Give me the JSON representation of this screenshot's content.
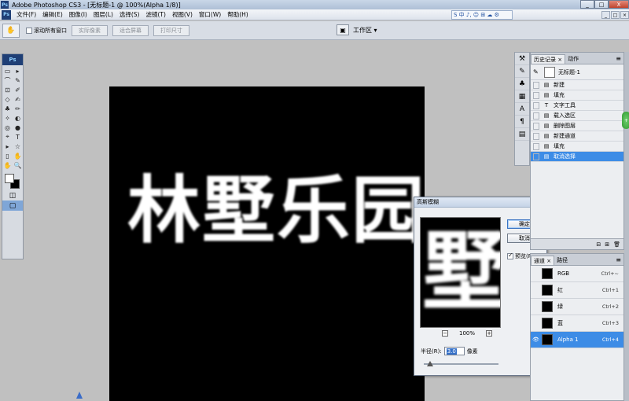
{
  "window": {
    "title": "Adobe Photoshop CS3 - [无标题-1 @ 100%(Alpha 1/8)]",
    "logo": "Ps",
    "controls": [
      "_",
      "□",
      "X"
    ]
  },
  "menu": {
    "logo": "Ps",
    "items": [
      "文件(F)",
      "编辑(E)",
      "图像(I)",
      "图层(L)",
      "选择(S)",
      "滤镜(T)",
      "视图(V)",
      "窗口(W)",
      "帮助(H)"
    ]
  },
  "ime": {
    "label": "S 中 ♪, ☺ ⊞ ☁ ⚙"
  },
  "options": {
    "scroll_all_label": "滚动所有窗口",
    "actual_pixels": "实际像素",
    "fit_screen": "适合屏幕",
    "print_size": "打印尺寸",
    "workspace": "工作区 ▾"
  },
  "toolbox": {
    "logo": "Ps",
    "tools": [
      "▭",
      "▸",
      "⌒",
      "✎",
      "⊡",
      "✐",
      "◇",
      "✍",
      "♣",
      "✏",
      "✧",
      "◐",
      "◎",
      "●",
      "⌖",
      "T",
      "▸",
      "☆",
      "▯",
      "✋",
      "✋",
      "🔍"
    ]
  },
  "canvas": {
    "text": "林墅乐园"
  },
  "dialog": {
    "title": "高斯模糊",
    "preview_text": "墅乐",
    "ok": "确定",
    "cancel": "取消",
    "preview_label": "预览(P)",
    "zoom": "100%",
    "radius_label": "半径(R):",
    "radius_value": "3.0",
    "radius_unit": "像素"
  },
  "history": {
    "tab_history": "历史记录 ×",
    "tab_actions": "动作",
    "snapshot": "无标题-1",
    "items": [
      {
        "icon": "▤",
        "label": "新建"
      },
      {
        "icon": "▤",
        "label": "填充"
      },
      {
        "icon": "T",
        "label": "文字工具"
      },
      {
        "icon": "▤",
        "label": "载入选区"
      },
      {
        "icon": "▤",
        "label": "删除图层"
      },
      {
        "icon": "▤",
        "label": "新建通道"
      },
      {
        "icon": "▤",
        "label": "填充"
      },
      {
        "icon": "▤",
        "label": "取消选择"
      }
    ],
    "footer": [
      "⊟",
      "⊞",
      "🗑"
    ]
  },
  "channels": {
    "tab_channels": "通道 ×",
    "tab_paths": "路径",
    "rows": [
      {
        "name": "RGB",
        "shortcut": "Ctrl+~"
      },
      {
        "name": "红",
        "shortcut": "Ctrl+1"
      },
      {
        "name": "绿",
        "shortcut": "Ctrl+2"
      },
      {
        "name": "蓝",
        "shortcut": "Ctrl+3"
      },
      {
        "name": "Alpha 1",
        "shortcut": "Ctrl+4"
      }
    ]
  },
  "colors": {
    "accent": "#3d8ce6",
    "canvas_bg": "#000000",
    "canvas_fg": "#ffffff"
  }
}
